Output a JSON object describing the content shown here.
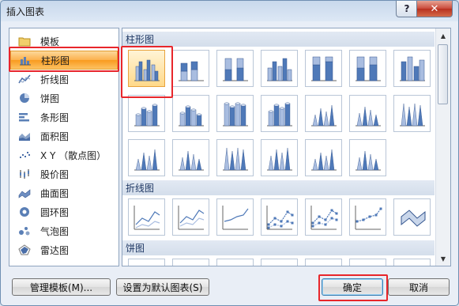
{
  "window": {
    "title": "插入图表",
    "help_label": "?",
    "close_label": "✕"
  },
  "categories": [
    {
      "label": "模板",
      "icon": "folder-icon"
    },
    {
      "label": "柱形图",
      "icon": "column-chart-icon",
      "selected": true
    },
    {
      "label": "折线图",
      "icon": "line-chart-icon"
    },
    {
      "label": "饼图",
      "icon": "pie-chart-icon"
    },
    {
      "label": "条形图",
      "icon": "bar-chart-icon"
    },
    {
      "label": "面积图",
      "icon": "area-chart-icon"
    },
    {
      "label": "X Y （散点图）",
      "icon": "scatter-chart-icon"
    },
    {
      "label": "股价图",
      "icon": "stock-chart-icon"
    },
    {
      "label": "曲面图",
      "icon": "surface-chart-icon"
    },
    {
      "label": "圆环图",
      "icon": "doughnut-chart-icon"
    },
    {
      "label": "气泡图",
      "icon": "bubble-chart-icon"
    },
    {
      "label": "雷达图",
      "icon": "radar-chart-icon"
    }
  ],
  "sections": [
    {
      "title": "柱形图"
    },
    {
      "title": "折线图"
    },
    {
      "title": "饼图"
    }
  ],
  "buttons": {
    "manage_templates": "管理模板(M)...",
    "set_default": "设置为默认图表(S)",
    "ok": "确定",
    "cancel": "取消"
  },
  "colors": {
    "accent_red": "#e8262b",
    "selection_orange": "#fbb04c",
    "chart_blue": "#4f79b8"
  }
}
